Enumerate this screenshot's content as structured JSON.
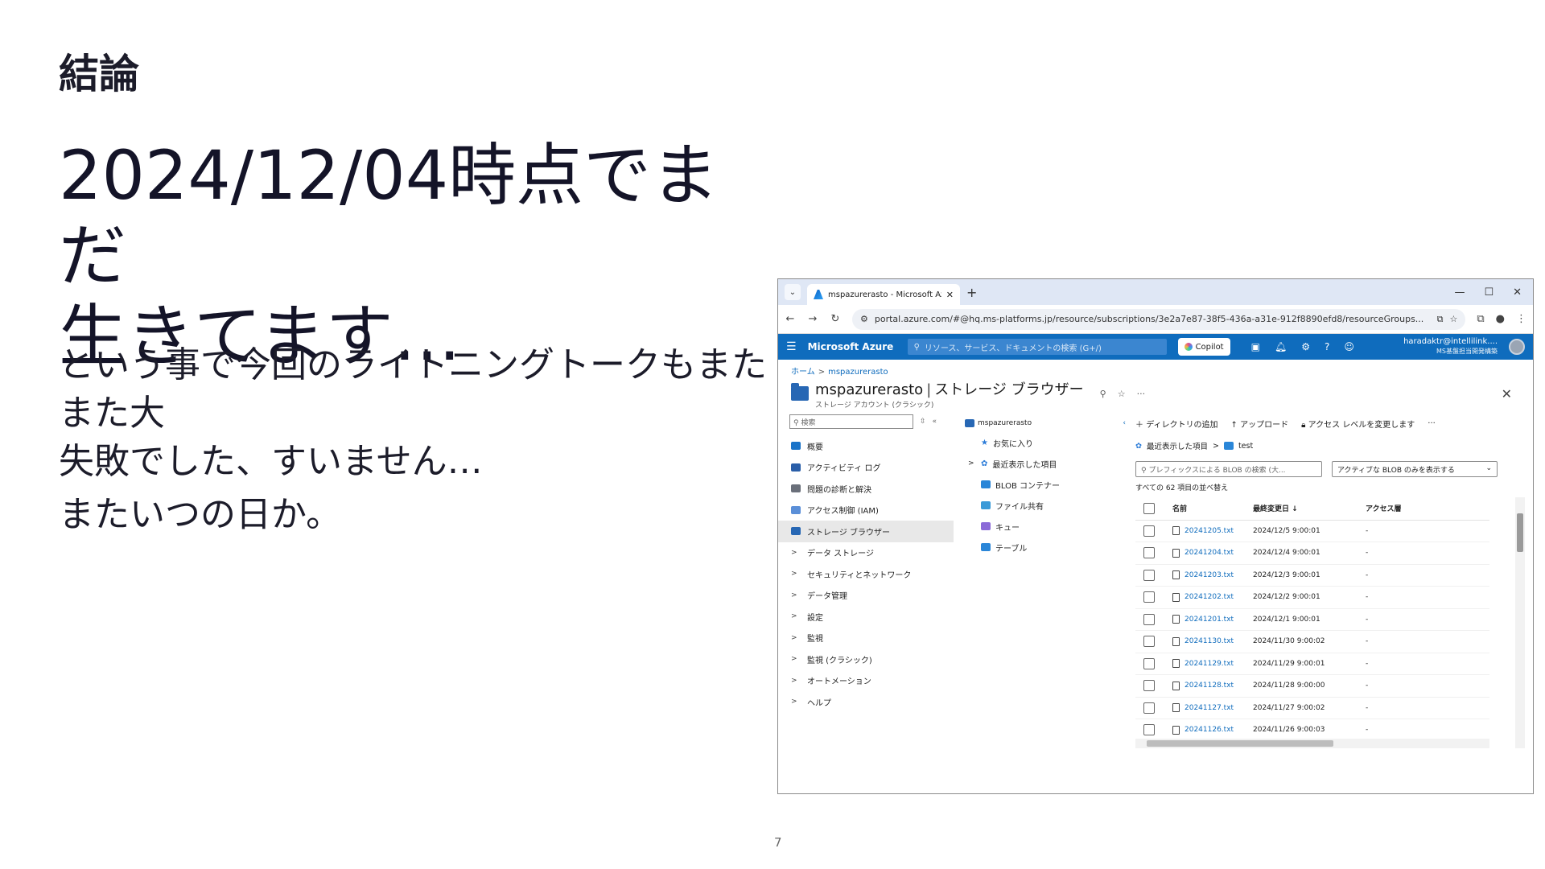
{
  "slide": {
    "heading": "結論",
    "title_line1": "2024/12/04時点でまだ",
    "title_line2": "生きてます…",
    "body_line1": "という事で今回のライトニングトークもまたまた大",
    "body_line2": "失敗でした、すいません…",
    "body_line3": "またいつの日か。",
    "page_number": "7"
  },
  "browser": {
    "tab_title": "mspazurerasto - Microsoft Azure",
    "url": "portal.azure.com/#@hq.ms-platforms.jp/resource/subscriptions/3e2a7e87-38f5-436a-a31e-912f8890efd8/resourceGroups..."
  },
  "azure": {
    "brand": "Microsoft Azure",
    "search_placeholder": "リソース、サービス、ドキュメントの検索 (G+/)",
    "copilot": "Copilot",
    "account_email": "haradaktr@intellilink....",
    "account_org": "MS基盤担当開発構築",
    "breadcrumb_home": "ホーム",
    "breadcrumb_resource": "mspazurerasto",
    "resource_name": "mspazurerasto",
    "blade_name": "ストレージ ブラウザー",
    "resource_type": "ストレージ アカウント (クラシック)"
  },
  "sidebar": {
    "search_placeholder": "検索",
    "items": [
      {
        "label": "概要"
      },
      {
        "label": "アクティビティ ログ"
      },
      {
        "label": "問題の診断と解決"
      },
      {
        "label": "アクセス制御 (IAM)"
      },
      {
        "label": "ストレージ ブラウザー"
      },
      {
        "label": "データ ストレージ"
      },
      {
        "label": "セキュリティとネットワーク"
      },
      {
        "label": "データ管理"
      },
      {
        "label": "設定"
      },
      {
        "label": "監視"
      },
      {
        "label": "監視 (クラシック)"
      },
      {
        "label": "オートメーション"
      },
      {
        "label": "ヘルプ"
      }
    ]
  },
  "tree": {
    "root": "mspazurerasto",
    "items": [
      {
        "label": "お気に入り"
      },
      {
        "label": "最近表示した項目"
      },
      {
        "label": "BLOB コンテナー"
      },
      {
        "label": "ファイル共有"
      },
      {
        "label": "キュー"
      },
      {
        "label": "テーブル"
      }
    ]
  },
  "main": {
    "toolbar": {
      "add_directory": "ディレクトリの追加",
      "upload": "アップロード",
      "access_level": "アクセス レベルを変更します",
      "more": "···"
    },
    "path_recent": "最近表示した項目",
    "path_container": "test",
    "filter_placeholder": "プレフィックスによる BLOB の検索 (大...",
    "filter_select": "アクティブな BLOB のみを表示する",
    "count_text": "すべての 62 項目の並べ替え",
    "columns": {
      "name": "名前",
      "modified": "最終変更日 ↓",
      "access": "アクセス層"
    },
    "rows": [
      {
        "name": "20241205.txt",
        "modified": "2024/12/5 9:00:01",
        "access": "-"
      },
      {
        "name": "20241204.txt",
        "modified": "2024/12/4 9:00:01",
        "access": "-"
      },
      {
        "name": "20241203.txt",
        "modified": "2024/12/3 9:00:01",
        "access": "-"
      },
      {
        "name": "20241202.txt",
        "modified": "2024/12/2 9:00:01",
        "access": "-"
      },
      {
        "name": "20241201.txt",
        "modified": "2024/12/1 9:00:01",
        "access": "-"
      },
      {
        "name": "20241130.txt",
        "modified": "2024/11/30 9:00:02",
        "access": "-"
      },
      {
        "name": "20241129.txt",
        "modified": "2024/11/29 9:00:01",
        "access": "-"
      },
      {
        "name": "20241128.txt",
        "modified": "2024/11/28 9:00:00",
        "access": "-"
      },
      {
        "name": "20241127.txt",
        "modified": "2024/11/27 9:00:02",
        "access": "-"
      },
      {
        "name": "20241126.txt",
        "modified": "2024/11/26 9:00:03",
        "access": "-"
      }
    ]
  },
  "colors": {
    "azure_blue": "#0f6cbd",
    "tab_bar": "#dfe7f5"
  }
}
